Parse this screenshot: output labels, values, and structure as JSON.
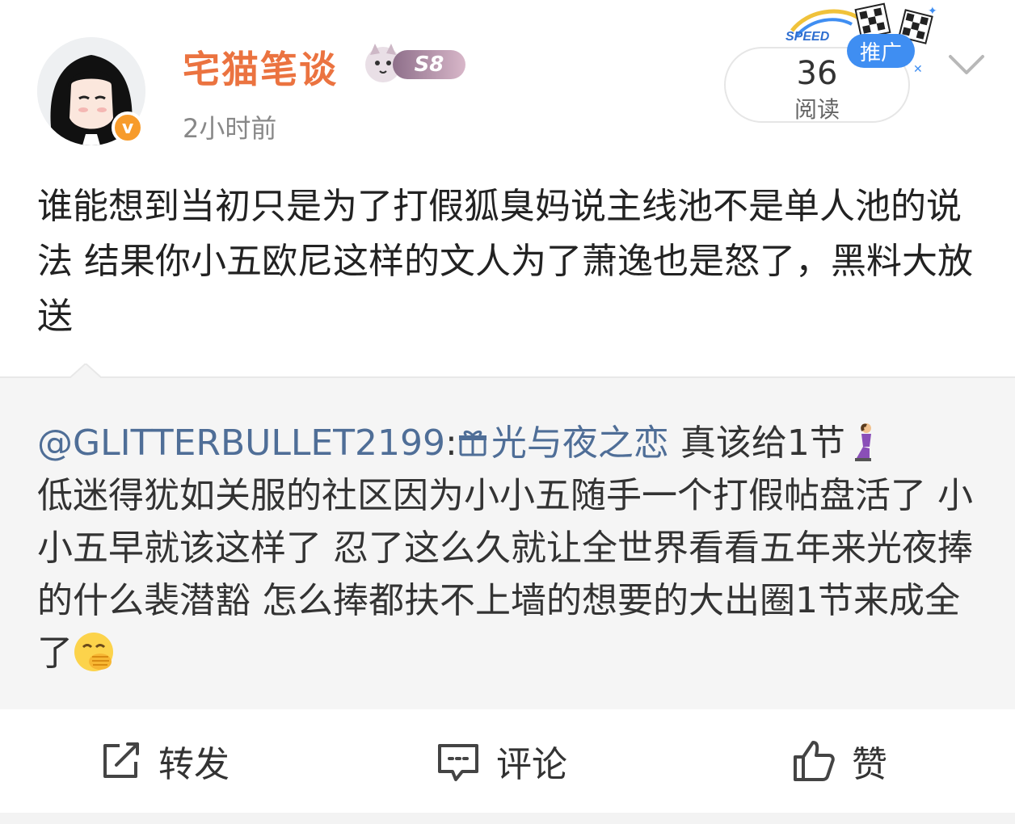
{
  "header": {
    "username": "宅猫笔谈",
    "level_badge": "S8",
    "timestamp": "2小时前",
    "verified_mark": "v",
    "read_count": "36",
    "read_label": "阅读",
    "promo_tag": "推广",
    "promo_logo_text": "SPEED"
  },
  "post": {
    "text": "谁能想到当初只是为了打假狐臭妈说主线池不是单人池的说法 结果你小五欧尼这样的文人为了萧逸也是怒了，黑料大放送"
  },
  "repost": {
    "mention": "@GLITTERBULLET2199",
    "separator": ":",
    "topic": "光与夜之恋",
    "body": " 真该给1节",
    "body2": "低迷得犹如关服的社区因为小小五随手一个打假帖盘活了 小小五早就该这样了 忍了这么久就让全世界看看五年来光夜捧的什么裴潜豁 怎么捧都扶不上墙的想要的大出圈1节来成全了"
  },
  "actions": {
    "forward": "转发",
    "comment": "评论",
    "like": "赞"
  },
  "colors": {
    "username": "#eb7340",
    "link": "#4f6e97",
    "promo": "#3f8ef2",
    "verified": "#f79b2b"
  },
  "icons": {
    "forward": "forward-icon",
    "comment": "comment-icon",
    "like": "thumbs-up-icon",
    "menu": "chevron-down-icon",
    "topic": "topic-gift-icon"
  }
}
